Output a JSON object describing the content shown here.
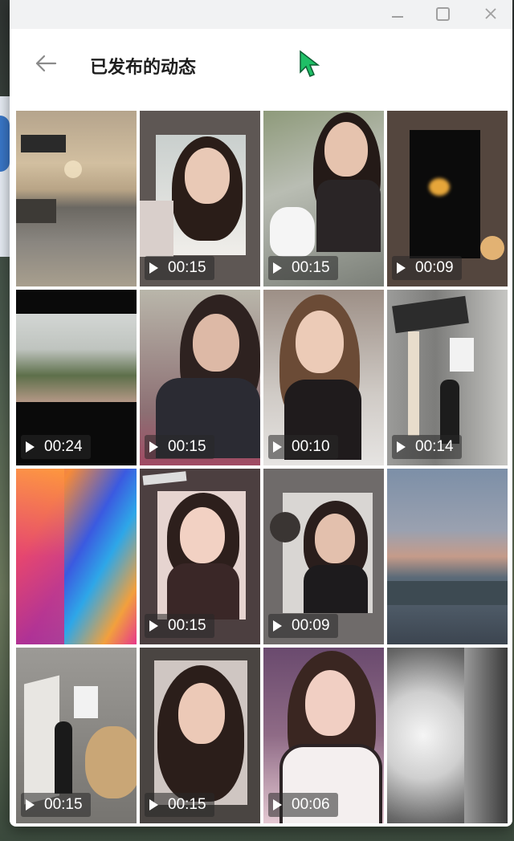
{
  "window": {
    "controls": {
      "minimize_icon": "minimize-icon",
      "maximize_icon": "maximize-icon",
      "close_icon": "close-icon"
    }
  },
  "header": {
    "back_icon": "arrow-left-icon",
    "title": "已发布的动态"
  },
  "posts": [
    {
      "duration": "",
      "kind": "photo"
    },
    {
      "duration": "00:15",
      "kind": "video"
    },
    {
      "duration": "00:15",
      "kind": "video"
    },
    {
      "duration": "00:09",
      "kind": "video"
    },
    {
      "duration": "00:24",
      "kind": "video"
    },
    {
      "duration": "00:15",
      "kind": "video"
    },
    {
      "duration": "00:10",
      "kind": "video"
    },
    {
      "duration": "00:14",
      "kind": "video"
    },
    {
      "duration": "",
      "kind": "photo"
    },
    {
      "duration": "00:15",
      "kind": "video"
    },
    {
      "duration": "00:09",
      "kind": "video"
    },
    {
      "duration": "",
      "kind": "photo"
    },
    {
      "duration": "00:15",
      "kind": "video"
    },
    {
      "duration": "00:15",
      "kind": "video"
    },
    {
      "duration": "00:06",
      "kind": "video"
    },
    {
      "duration": "",
      "kind": "photo"
    }
  ],
  "colors": {
    "accent_cursor": "#1fbf66",
    "overlay": "#28282880",
    "title_text": "#1e1e1e"
  }
}
